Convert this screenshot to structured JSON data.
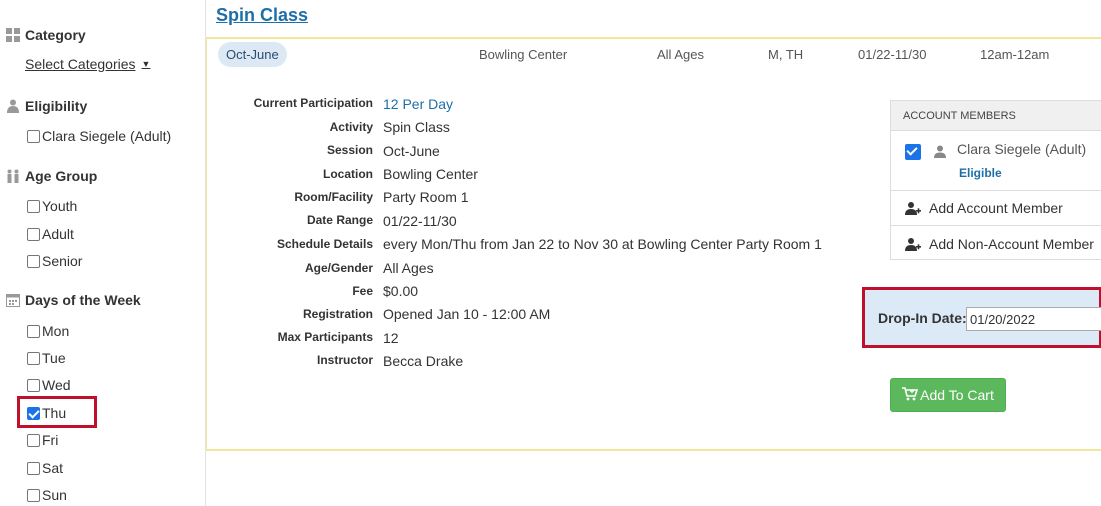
{
  "sidebar": {
    "category": {
      "title": "Category",
      "select_label": "Select Categories"
    },
    "eligibility": {
      "title": "Eligibility",
      "options": [
        {
          "label": "Clara Siegele (Adult)",
          "checked": false
        }
      ]
    },
    "age_group": {
      "title": "Age Group",
      "options": [
        {
          "label": "Youth",
          "checked": false
        },
        {
          "label": "Adult",
          "checked": false
        },
        {
          "label": "Senior",
          "checked": false
        }
      ]
    },
    "days": {
      "title": "Days of the Week",
      "options": [
        {
          "label": "Mon",
          "checked": false
        },
        {
          "label": "Tue",
          "checked": false
        },
        {
          "label": "Wed",
          "checked": false
        },
        {
          "label": "Thu",
          "checked": true
        },
        {
          "label": "Fri",
          "checked": false
        },
        {
          "label": "Sat",
          "checked": false
        },
        {
          "label": "Sun",
          "checked": false
        }
      ]
    }
  },
  "activity": {
    "title": "Spin Class",
    "summary": {
      "session": "Oct-June",
      "location": "Bowling Center",
      "ages": "All Ages",
      "days": "M, TH",
      "dates": "01/22-11/30",
      "times": "12am-12am"
    },
    "details": [
      {
        "label": "Current Participation",
        "value": "12 Per Day"
      },
      {
        "label": "Activity",
        "value": "Spin Class"
      },
      {
        "label": "Session",
        "value": "Oct-June"
      },
      {
        "label": "Location",
        "value": "Bowling Center"
      },
      {
        "label": "Room/Facility",
        "value": "Party Room 1"
      },
      {
        "label": "Date Range",
        "value": "01/22-11/30"
      },
      {
        "label": "Schedule Details",
        "value": "every Mon/Thu from Jan 22 to Nov 30 at Bowling Center Party Room 1"
      },
      {
        "label": "Age/Gender",
        "value": "All Ages"
      },
      {
        "label": "Fee",
        "value": "$0.00"
      },
      {
        "label": "Registration",
        "value": "Opened Jan 10 - 12:00 AM"
      },
      {
        "label": "Max Participants",
        "value": "12"
      },
      {
        "label": "Instructor",
        "value": "Becca Drake"
      }
    ]
  },
  "account_members": {
    "header": "ACCOUNT MEMBERS",
    "member": {
      "name": "Clara Siegele (Adult)",
      "status": "Eligible",
      "checked": true
    },
    "add_account_member": "Add Account Member",
    "add_non_account_member": "Add Non-Account Member"
  },
  "drop_in": {
    "label": "Drop-In Date:",
    "value": "01/20/2022"
  },
  "cart": {
    "label": "Add To Cart"
  },
  "colors": {
    "link": "#1e6fa8",
    "highlight_border": "#c0102b",
    "cart_green": "#5cb85c",
    "panel_border": "#f0e79a"
  }
}
